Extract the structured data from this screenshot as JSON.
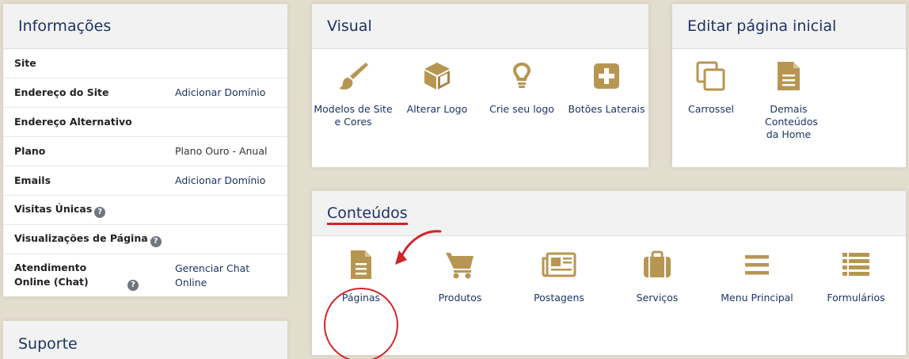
{
  "colors": {
    "accent_gold": "#b79651",
    "title_blue": "#1c3366",
    "highlight_red": "#d3222a"
  },
  "info": {
    "title": "Informações",
    "rows": [
      {
        "label": "Site",
        "value": ""
      },
      {
        "label": "Endereço do Site",
        "value": "Adicionar Domínio"
      },
      {
        "label": "Endereço Alternativo",
        "value": ""
      },
      {
        "label": "Plano",
        "value": "Plano Ouro - Anual"
      },
      {
        "label": "Emails",
        "value": "Adicionar Domínio"
      },
      {
        "label": "Visitas Únicas",
        "value": ""
      },
      {
        "label": "Visualizações de Página",
        "value": ""
      },
      {
        "label": "Atendimento Online (Chat)",
        "value": "Gerenciar Chat Online"
      }
    ],
    "help_glyph": "?"
  },
  "support": {
    "title": "Suporte"
  },
  "visual": {
    "title": "Visual",
    "tiles": [
      {
        "label": "Modelos de Site e Cores",
        "icon": "paintbrush-icon"
      },
      {
        "label": "Alterar Logo",
        "icon": "cube-icon"
      },
      {
        "label": "Crie seu logo",
        "icon": "lightbulb-icon"
      },
      {
        "label": "Botões Laterais",
        "icon": "plus-square-icon"
      }
    ]
  },
  "editar": {
    "title": "Editar página inicial",
    "tiles": [
      {
        "label": "Carrossel",
        "icon": "copy-icon"
      },
      {
        "label": "Demais Conteúdos da Home",
        "icon": "document-icon"
      }
    ]
  },
  "conteudos": {
    "title": "Conteúdos",
    "tiles": [
      {
        "label": "Páginas",
        "icon": "document-icon"
      },
      {
        "label": "Produtos",
        "icon": "shopping-cart-icon"
      },
      {
        "label": "Postagens",
        "icon": "newspaper-icon"
      },
      {
        "label": "Serviços",
        "icon": "briefcase-icon"
      },
      {
        "label": "Menu Principal",
        "icon": "menu-bars-icon"
      },
      {
        "label": "Formulários",
        "icon": "list-icon"
      }
    ]
  }
}
